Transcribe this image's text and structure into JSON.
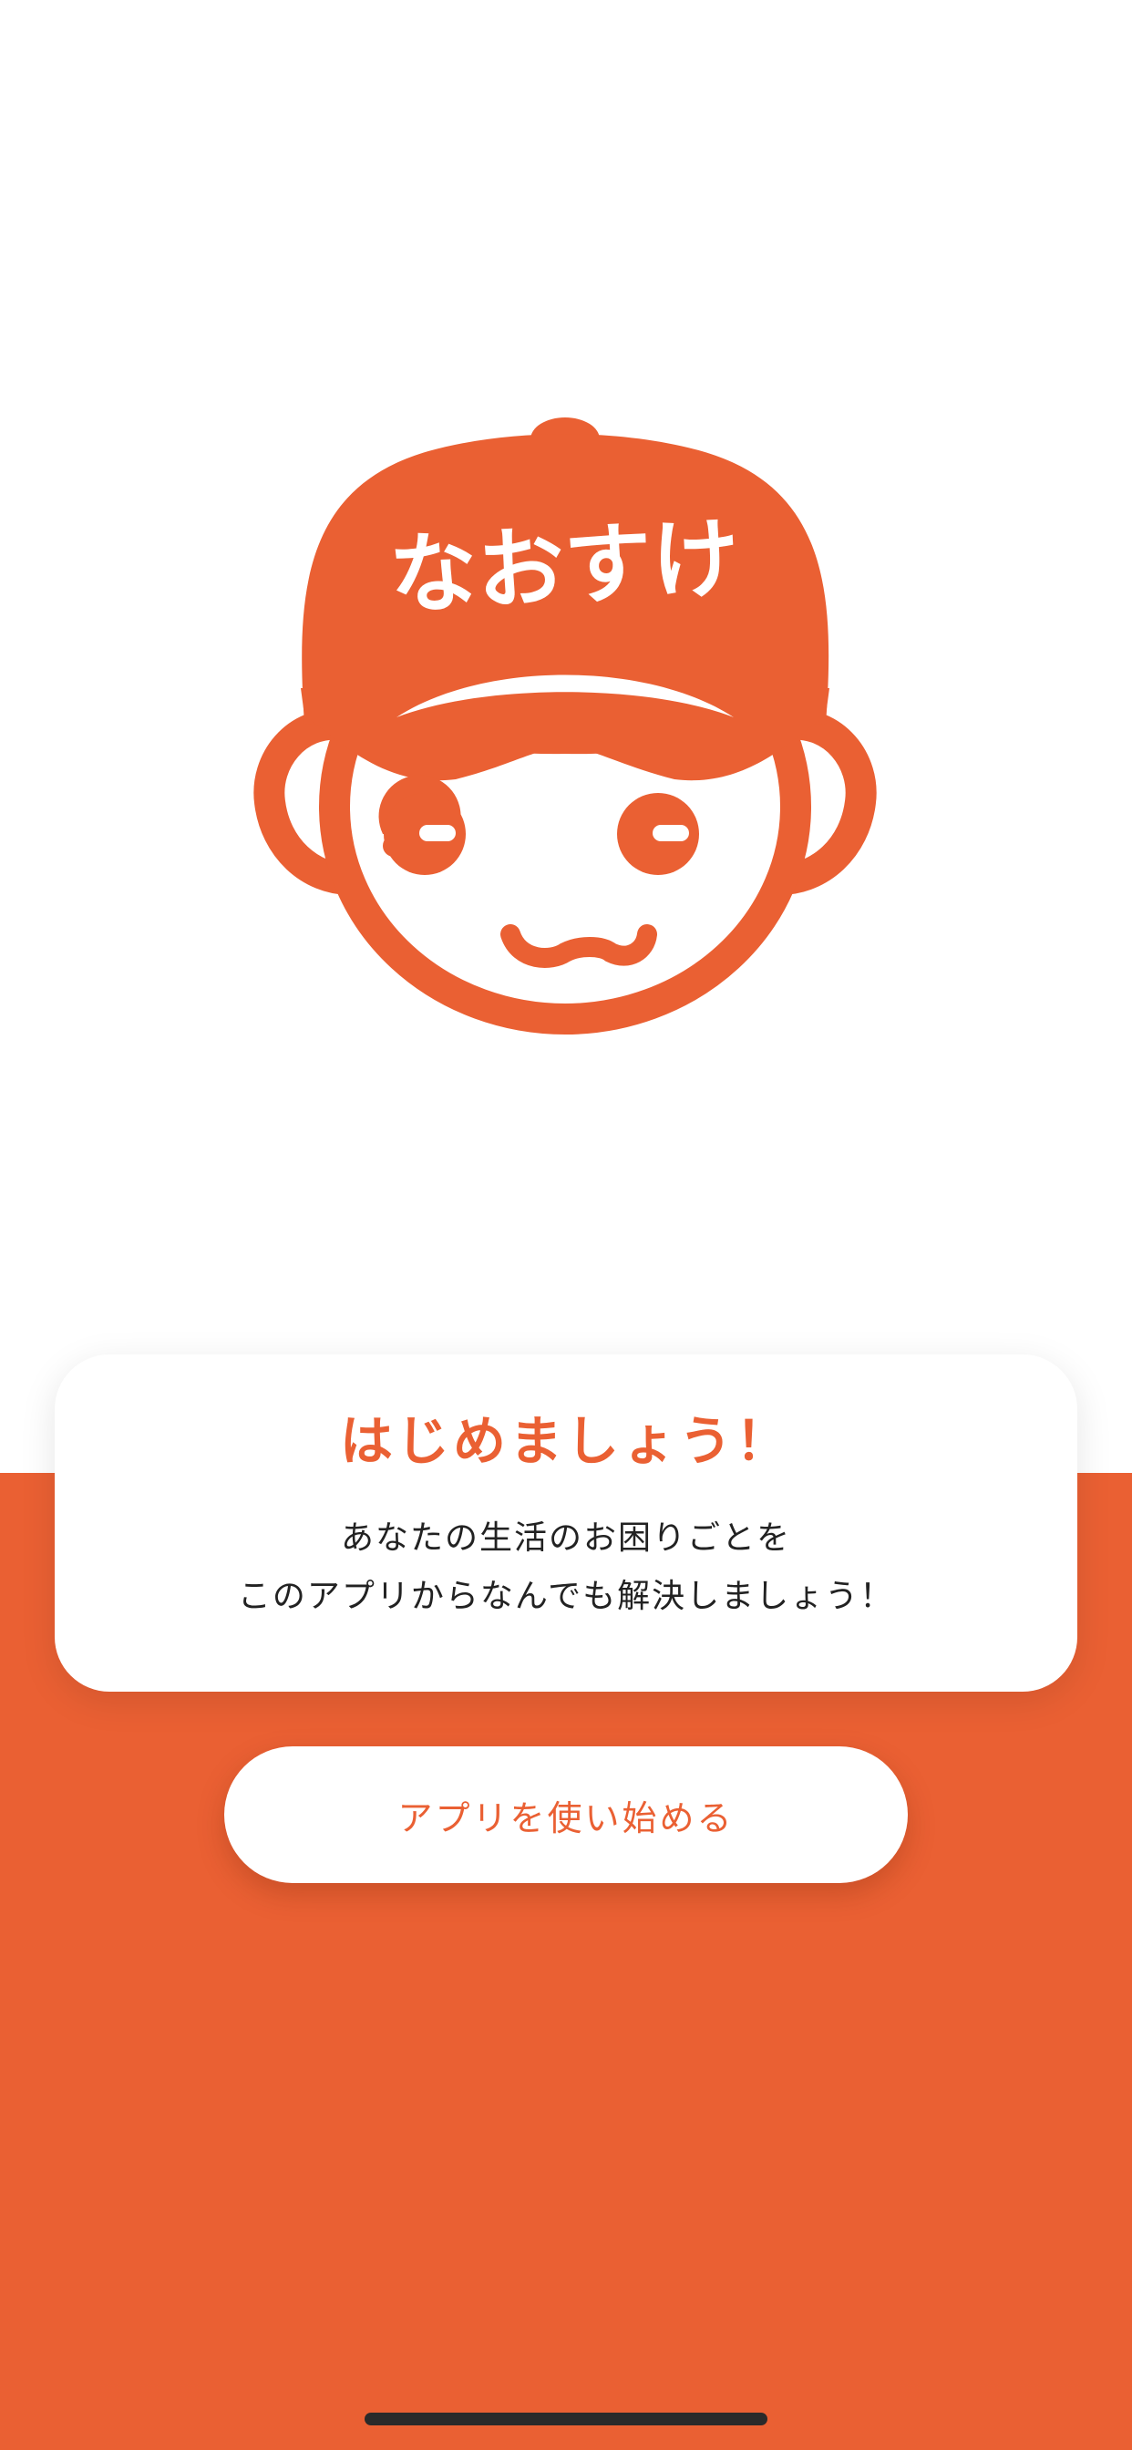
{
  "logo": {
    "text": "なおすけ",
    "icon": "mascot-boy-with-cap-icon",
    "color": "#EA6033"
  },
  "intro_card": {
    "title": "はじめましょう！",
    "body_line1": "あなたの生活のお困りごとを",
    "body_line2": "このアプリからなんでも解決しましょう！"
  },
  "start_button": {
    "label": "アプリを使い始める"
  },
  "colors": {
    "accent": "#EA6033",
    "background": "#FFFFFF",
    "text": "#222222"
  }
}
